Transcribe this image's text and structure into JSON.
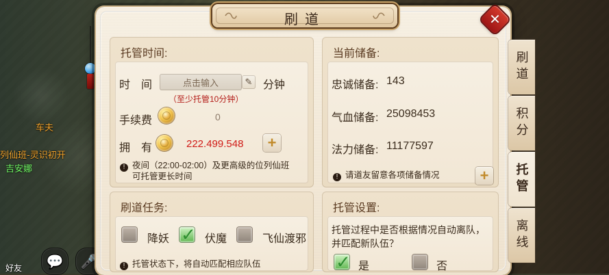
{
  "window": {
    "title": "刷道",
    "close_label": "✕"
  },
  "scene": {
    "npc_name": "车夫",
    "line1": "列仙班-灵识初开",
    "player_name": "吉安娜",
    "bottom_left_partial": "好友"
  },
  "tabs": [
    {
      "label": "刷道",
      "active": false
    },
    {
      "label": "积分",
      "active": false
    },
    {
      "label": "托管",
      "active": true
    },
    {
      "label": "离线",
      "active": false
    }
  ],
  "panels": {
    "hosting_time": {
      "title": "托管时间:",
      "time_label": "时　间",
      "time_placeholder": "点击输入",
      "time_unit": "分钟",
      "time_hint": "（至少托管10分钟）",
      "fee_label": "手续费",
      "fee_value": "0",
      "have_label": "拥　有",
      "have_value": "222.499.548",
      "note_line1": "夜间（22:00-02:00）及更高级的位列仙班",
      "note_line2": "可托管更长时间"
    },
    "current_reserves": {
      "title": "当前储备:",
      "loyalty_label": "忠诚储备:",
      "loyalty_value": "143",
      "hp_label": "气血储备:",
      "hp_value": "25098453",
      "mana_label": "法力储备:",
      "mana_value": "11177597",
      "note": "请道友留意各项储备情况"
    },
    "tasks": {
      "title": "刷道任务:",
      "options": [
        {
          "label": "降妖",
          "checked": false
        },
        {
          "label": "伏魔",
          "checked": true
        },
        {
          "label": "飞仙渡邪",
          "checked": false
        }
      ],
      "note": "托管状态下，将自动匹配相应队伍"
    },
    "hosting_settings": {
      "title": "托管设置:",
      "question_line1": "托管过程中是否根据情况自动离队，",
      "question_line2": "并匹配新队伍？",
      "yes_label": "是",
      "no_label": "否",
      "yes_checked": true,
      "no_checked": false
    }
  },
  "icons": {
    "info": "info-icon",
    "coin": "coin-icon",
    "plus": "plus-icon",
    "pencil": "pencil-icon",
    "chat": "chat-icon",
    "mic": "microphone-icon"
  },
  "colors": {
    "red_value": "#d01a16",
    "accent_green": "#5fb64f"
  }
}
